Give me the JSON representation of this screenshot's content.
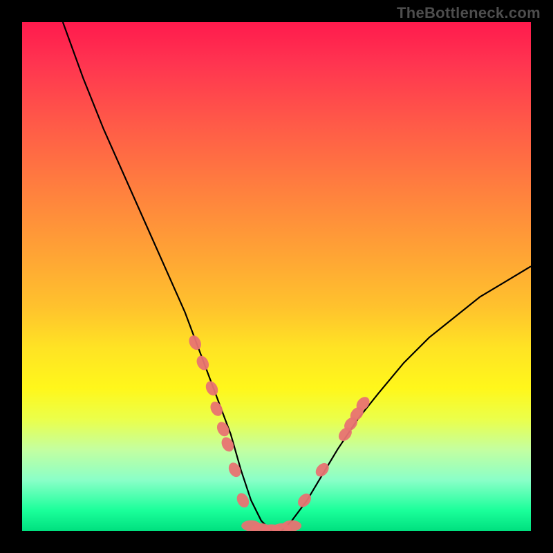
{
  "watermark": "TheBottleneck.com",
  "colors": {
    "marker": "#e87372",
    "curve": "#000000",
    "gradient_top": "#ff1a4d",
    "gradient_bottom": "#00e07f",
    "frame": "#000000"
  },
  "chart_data": {
    "type": "line",
    "title": "",
    "xlabel": "",
    "ylabel": "",
    "xlim": [
      0,
      100
    ],
    "ylim": [
      0,
      100
    ],
    "description": "V-shaped bottleneck curve on rainbow vertical gradient. Minimum (≈0) near x≈45–50. Left branch rises to ≈100 at x≈8; right branch rises to ≈52 at x≈100. Salmon markers cluster on both branches near the trough.",
    "series": [
      {
        "name": "curve",
        "x": [
          8,
          12,
          16,
          20,
          24,
          28,
          32,
          35,
          38,
          41,
          43,
          45,
          47,
          49,
          51,
          53,
          56,
          59,
          62,
          66,
          70,
          75,
          80,
          85,
          90,
          95,
          100
        ],
        "y": [
          100,
          89,
          79,
          70,
          61,
          52,
          43,
          35,
          27,
          19,
          12,
          6,
          2,
          0,
          0,
          2,
          6,
          11,
          16,
          22,
          27,
          33,
          38,
          42,
          46,
          49,
          52
        ]
      }
    ],
    "markers_left": [
      {
        "x": 34.0,
        "y": 37
      },
      {
        "x": 35.5,
        "y": 33
      },
      {
        "x": 37.3,
        "y": 28
      },
      {
        "x": 38.2,
        "y": 24
      },
      {
        "x": 39.5,
        "y": 20
      },
      {
        "x": 40.4,
        "y": 17
      },
      {
        "x": 41.8,
        "y": 12
      },
      {
        "x": 43.4,
        "y": 6
      }
    ],
    "markers_bottom": [
      {
        "x": 45.0,
        "y": 1.0
      },
      {
        "x": 47.0,
        "y": 0.4
      },
      {
        "x": 49.0,
        "y": 0.2
      },
      {
        "x": 51.0,
        "y": 0.4
      },
      {
        "x": 53.0,
        "y": 1.0
      }
    ],
    "markers_right": [
      {
        "x": 55.5,
        "y": 6
      },
      {
        "x": 59.0,
        "y": 12
      },
      {
        "x": 63.5,
        "y": 19
      },
      {
        "x": 64.6,
        "y": 21
      },
      {
        "x": 65.8,
        "y": 23
      },
      {
        "x": 67.0,
        "y": 25
      }
    ]
  }
}
